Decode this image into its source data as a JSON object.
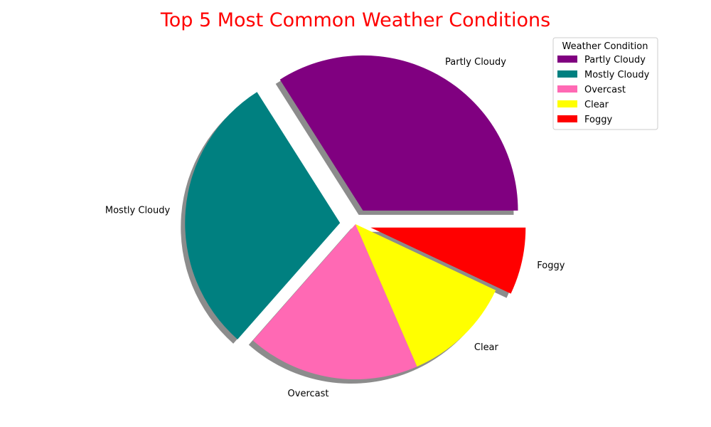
{
  "chart_data": {
    "type": "pie",
    "title": "Top 5 Most Common Weather Conditions",
    "title_color": "#ff0000",
    "categories": [
      "Partly Cloudy",
      "Mostly Cloudy",
      "Overcast",
      "Clear",
      "Foggy"
    ],
    "values": [
      34.0,
      29.5,
      18.0,
      11.5,
      7.0
    ],
    "colors": [
      "#800080",
      "#008080",
      "#ff69b4",
      "#ffff00",
      "#ff0000"
    ],
    "explode": [
      true,
      true,
      false,
      false,
      true
    ],
    "shadow": true,
    "legend": {
      "title": "Weather Condition",
      "placement": "top-right"
    }
  }
}
